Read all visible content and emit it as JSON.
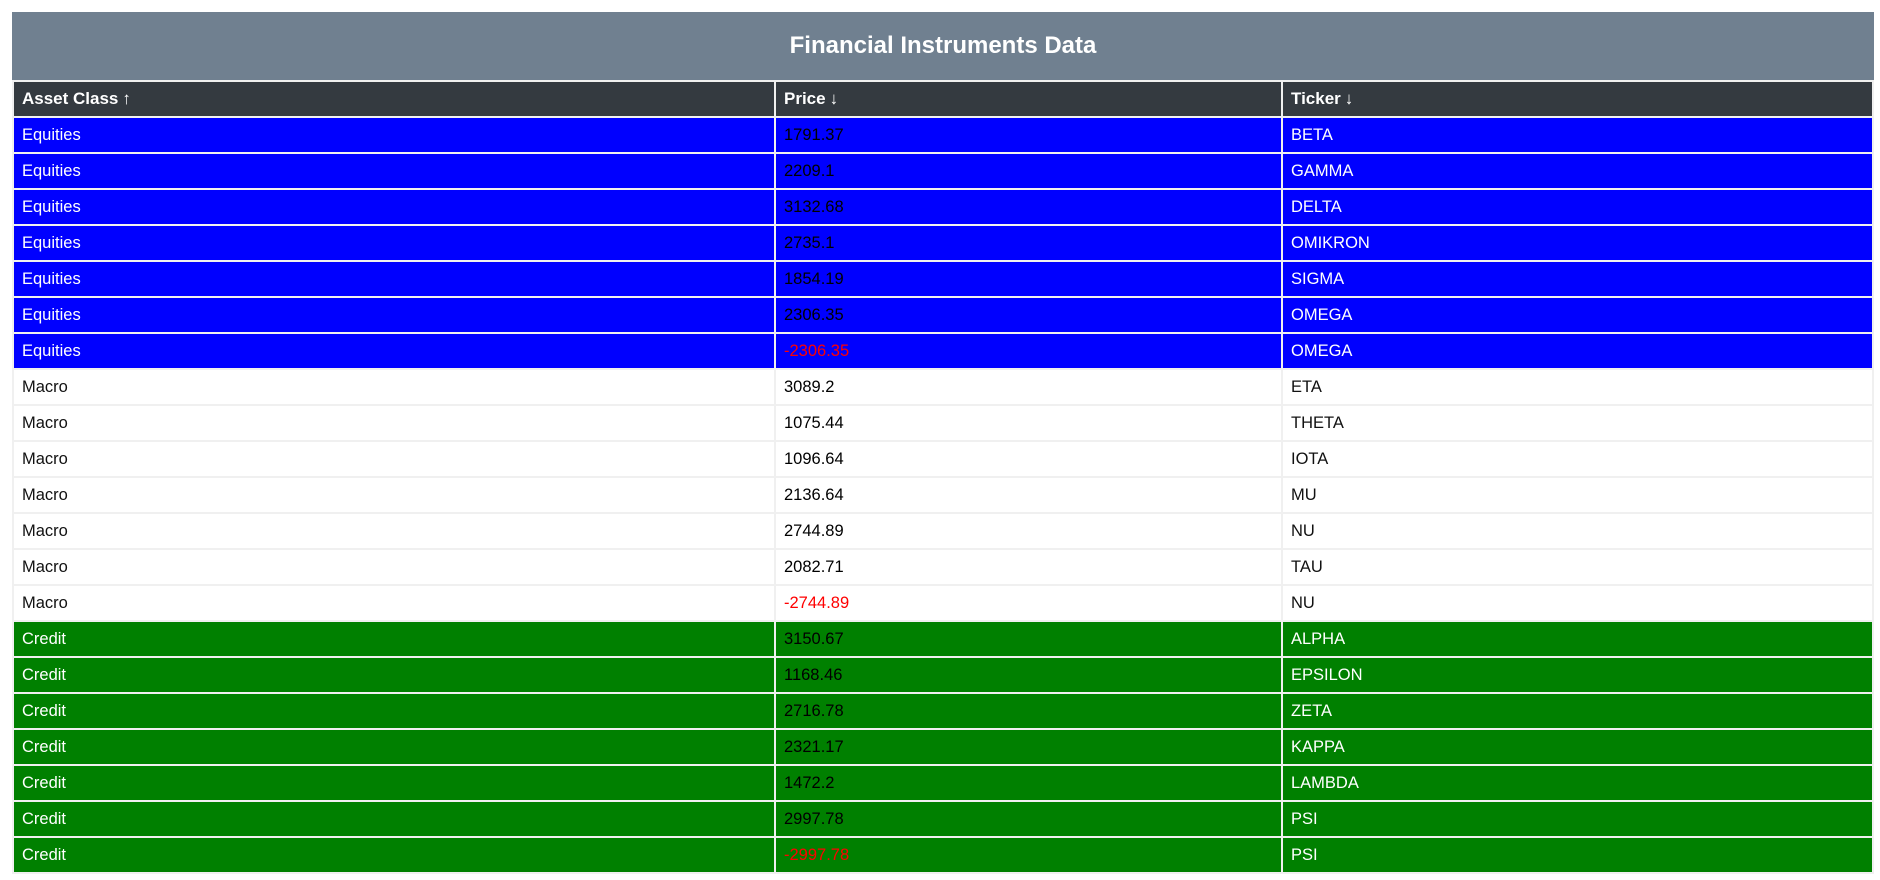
{
  "title": "Financial Instruments Data",
  "columns": [
    {
      "label": "Asset Class",
      "sort_arrow": "↑"
    },
    {
      "label": "Price",
      "sort_arrow": "↓"
    },
    {
      "label": "Ticker",
      "sort_arrow": "↓"
    }
  ],
  "colors": {
    "title_bg": "#708090",
    "header_bg": "#343a40",
    "equities_bg": "#0000ff",
    "macro_bg": "#ffffff",
    "credit_bg": "#008000",
    "negative_price": "#ff0000"
  },
  "rows": [
    {
      "asset_class": "Equities",
      "price": "1791.37",
      "ticker": "BETA",
      "negative": false
    },
    {
      "asset_class": "Equities",
      "price": "2209.1",
      "ticker": "GAMMA",
      "negative": false
    },
    {
      "asset_class": "Equities",
      "price": "3132.68",
      "ticker": "DELTA",
      "negative": false
    },
    {
      "asset_class": "Equities",
      "price": "2735.1",
      "ticker": "OMIKRON",
      "negative": false
    },
    {
      "asset_class": "Equities",
      "price": "1854.19",
      "ticker": "SIGMA",
      "negative": false
    },
    {
      "asset_class": "Equities",
      "price": "2306.35",
      "ticker": "OMEGA",
      "negative": false
    },
    {
      "asset_class": "Equities",
      "price": "-2306.35",
      "ticker": "OMEGA",
      "negative": true
    },
    {
      "asset_class": "Macro",
      "price": "3089.2",
      "ticker": "ETA",
      "negative": false
    },
    {
      "asset_class": "Macro",
      "price": "1075.44",
      "ticker": "THETA",
      "negative": false
    },
    {
      "asset_class": "Macro",
      "price": "1096.64",
      "ticker": "IOTA",
      "negative": false
    },
    {
      "asset_class": "Macro",
      "price": "2136.64",
      "ticker": "MU",
      "negative": false
    },
    {
      "asset_class": "Macro",
      "price": "2744.89",
      "ticker": "NU",
      "negative": false
    },
    {
      "asset_class": "Macro",
      "price": "2082.71",
      "ticker": "TAU",
      "negative": false
    },
    {
      "asset_class": "Macro",
      "price": "-2744.89",
      "ticker": "NU",
      "negative": true
    },
    {
      "asset_class": "Credit",
      "price": "3150.67",
      "ticker": "ALPHA",
      "negative": false
    },
    {
      "asset_class": "Credit",
      "price": "1168.46",
      "ticker": "EPSILON",
      "negative": false
    },
    {
      "asset_class": "Credit",
      "price": "2716.78",
      "ticker": "ZETA",
      "negative": false
    },
    {
      "asset_class": "Credit",
      "price": "2321.17",
      "ticker": "KAPPA",
      "negative": false
    },
    {
      "asset_class": "Credit",
      "price": "1472.2",
      "ticker": "LAMBDA",
      "negative": false
    },
    {
      "asset_class": "Credit",
      "price": "2997.78",
      "ticker": "PSI",
      "negative": false
    },
    {
      "asset_class": "Credit",
      "price": "-2997.78",
      "ticker": "PSI",
      "negative": true
    }
  ]
}
